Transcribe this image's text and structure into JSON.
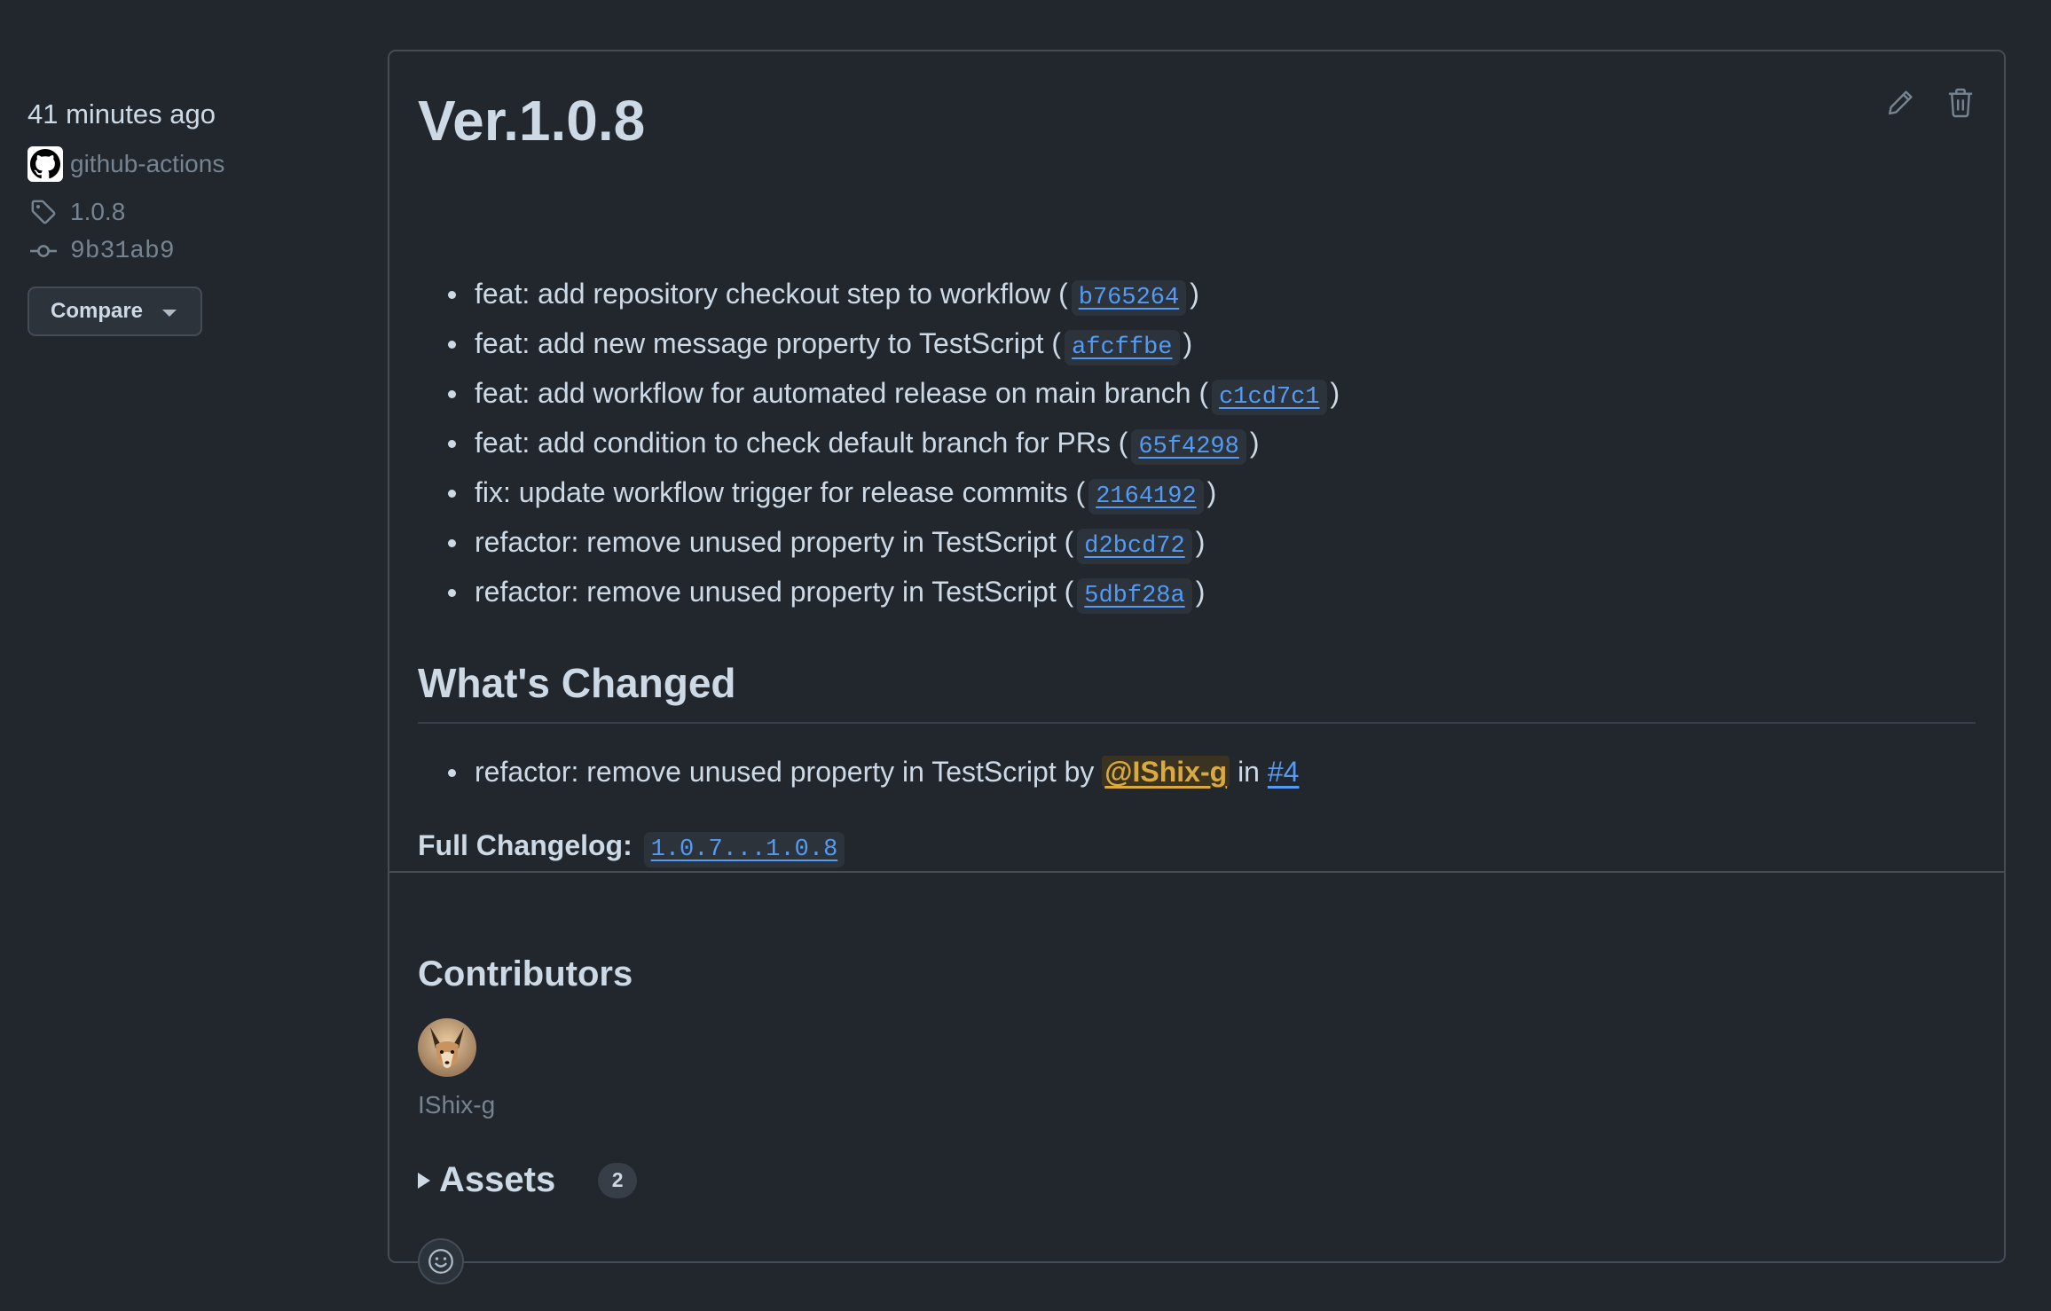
{
  "meta": {
    "time": "41 minutes ago",
    "author": "github-actions",
    "tag": "1.0.8",
    "commit": "9b31ab9",
    "compare_label": "Compare"
  },
  "release": {
    "title": "Ver.1.0.8",
    "changes": [
      {
        "text": "feat: add repository checkout step to workflow (",
        "sha": "b765264",
        "close": ")"
      },
      {
        "text": "feat: add new message property to TestScript (",
        "sha": "afcffbe",
        "close": ")"
      },
      {
        "text": "feat: add workflow for automated release on main branch (",
        "sha": "c1cd7c1",
        "close": ")"
      },
      {
        "text": "feat: add condition to check default branch for PRs (",
        "sha": "65f4298",
        "close": ")"
      },
      {
        "text": "fix: update workflow trigger for release commits (",
        "sha": "2164192",
        "close": ")"
      },
      {
        "text": "refactor: remove unused property in TestScript (",
        "sha": "d2bcd72",
        "close": ")"
      },
      {
        "text": "refactor: remove unused property in TestScript (",
        "sha": "5dbf28a",
        "close": ")"
      }
    ],
    "whats_changed": {
      "title": "What's Changed",
      "item": {
        "text": "refactor: remove unused property in TestScript by",
        "mention": "@IShix-g",
        "in": "in",
        "pr": "#4"
      }
    },
    "changelog": {
      "label": "Full Changelog:",
      "range": "1.0.7...1.0.8"
    },
    "contributors": {
      "title": "Contributors",
      "names": [
        "IShix-g"
      ]
    },
    "assets": {
      "label": "Assets",
      "count": "2"
    }
  },
  "icons": {
    "edit": "pencil-icon",
    "delete": "trash-icon",
    "tag": "tag-icon",
    "commit": "git-commit-icon",
    "reaction": "smiley-icon"
  },
  "colors": {
    "background": "#22272e",
    "link": "#539bf5",
    "mention": "#daaa3f",
    "text": "#cdd9e5",
    "muted": "#768390",
    "border": "#444c56"
  }
}
